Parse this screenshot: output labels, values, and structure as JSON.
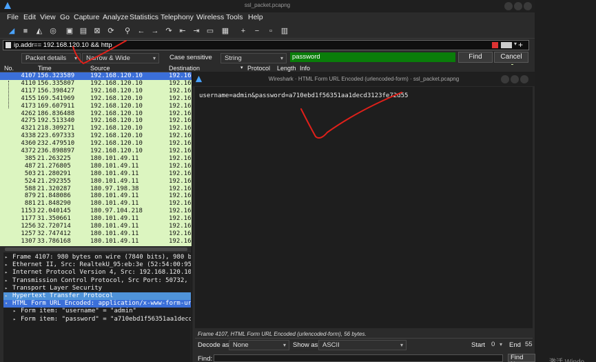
{
  "window": {
    "title": "ssl_packet.pcapng"
  },
  "menu": [
    "File",
    "Edit",
    "View",
    "Go",
    "Capture",
    "Analyze",
    "Statistics",
    "Telephony",
    "Wireless",
    "Tools",
    "Help"
  ],
  "toolbar_icons": [
    "shark-fin-icon",
    "stop-icon",
    "restart-icon",
    "options-gear-icon",
    "open-file-icon",
    "save-file-icon",
    "close-file-icon",
    "reload-icon",
    "find-packet-icon",
    "go-back-icon",
    "go-forward-icon",
    "go-to-packet-icon",
    "first-packet-icon",
    "last-packet-icon",
    "autoscroll-icon",
    "colorize-icon",
    "zoom-in-icon",
    "zoom-out-icon",
    "normal-size-icon",
    "resize-columns-icon"
  ],
  "filter": {
    "value": "ip.addr== 192.168.120.10 && http",
    "plus": "+"
  },
  "search": {
    "area": "Packet details",
    "char": "Narrow & Wide",
    "case": "Case sensitive",
    "type": "String",
    "value": "password",
    "find": "Find",
    "cancel": "Cancel"
  },
  "columns": [
    "No.",
    "Time",
    "Source",
    "Destination",
    "Protocol",
    "Length",
    "Info"
  ],
  "packets": [
    {
      "no": "4107",
      "time": "156.323589",
      "src": "192.168.120.10",
      "dst": "192.16",
      "selected": true
    },
    {
      "no": "4110",
      "time": "156.335807",
      "src": "192.168.120.10",
      "dst": "192.16"
    },
    {
      "no": "4117",
      "time": "156.398427",
      "src": "192.168.120.10",
      "dst": "192.16"
    },
    {
      "no": "4155",
      "time": "169.541969",
      "src": "192.168.120.10",
      "dst": "192.16"
    },
    {
      "no": "4173",
      "time": "169.607911",
      "src": "192.168.120.10",
      "dst": "192.16"
    },
    {
      "no": "4262",
      "time": "186.836488",
      "src": "192.168.120.10",
      "dst": "192.16"
    },
    {
      "no": "4275",
      "time": "192.513340",
      "src": "192.168.120.10",
      "dst": "192.16"
    },
    {
      "no": "4321",
      "time": "218.309271",
      "src": "192.168.120.10",
      "dst": "192.16"
    },
    {
      "no": "4338",
      "time": "223.697333",
      "src": "192.168.120.10",
      "dst": "192.16"
    },
    {
      "no": "4360",
      "time": "232.479510",
      "src": "192.168.120.10",
      "dst": "192.16"
    },
    {
      "no": "4372",
      "time": "236.898897",
      "src": "192.168.120.10",
      "dst": "192.16"
    },
    {
      "no": "385",
      "time": "21.263225",
      "src": "180.101.49.11",
      "dst": "192.16"
    },
    {
      "no": "487",
      "time": "21.276805",
      "src": "180.101.49.11",
      "dst": "192.16"
    },
    {
      "no": "503",
      "time": "21.280291",
      "src": "180.101.49.11",
      "dst": "192.16"
    },
    {
      "no": "524",
      "time": "21.292355",
      "src": "180.101.49.11",
      "dst": "192.16"
    },
    {
      "no": "588",
      "time": "21.320287",
      "src": "180.97.198.38",
      "dst": "192.16"
    },
    {
      "no": "879",
      "time": "21.848086",
      "src": "180.101.49.11",
      "dst": "192.16"
    },
    {
      "no": "881",
      "time": "21.848290",
      "src": "180.101.49.11",
      "dst": "192.16"
    },
    {
      "no": "1153",
      "time": "22.040145",
      "src": "180.97.104.218",
      "dst": "192.16"
    },
    {
      "no": "1177",
      "time": "31.350661",
      "src": "180.101.49.11",
      "dst": "192.16"
    },
    {
      "no": "1256",
      "time": "32.720714",
      "src": "180.101.49.11",
      "dst": "192.16"
    },
    {
      "no": "1257",
      "time": "32.747412",
      "src": "180.101.49.11",
      "dst": "192.16"
    },
    {
      "no": "1307",
      "time": "33.786168",
      "src": "180.101.49.11",
      "dst": "192.16"
    }
  ],
  "details": [
    {
      "text": "Frame 4107: 980 bytes on wire (7840 bits), 980 b",
      "indent": 0,
      "tri": "▸"
    },
    {
      "text": "Ethernet II, Src: RealtekU_95:eb:3e (52:54:00:95",
      "indent": 0,
      "tri": "▸"
    },
    {
      "text": "Internet Protocol Version 4, Src: 192.168.120.10",
      "indent": 0,
      "tri": "▸"
    },
    {
      "text": "Transmission Control Protocol, Src Port: 50732,",
      "indent": 0,
      "tri": "▸"
    },
    {
      "text": "Transport Layer Security",
      "indent": 0,
      "tri": "▸"
    },
    {
      "text": "Hypertext Transfer Protocol",
      "indent": 0,
      "tri": "▸",
      "hl": true
    },
    {
      "text": "HTML Form URL Encoded: application/x-www-form-ur",
      "indent": 0,
      "tri": "▾",
      "sel": true
    },
    {
      "text": "Form item: \"username\" = \"admin\"",
      "indent": 1,
      "tri": "▸"
    },
    {
      "text": "Form item: \"password\" = \"a710ebd1f56351aa1decd",
      "indent": 1,
      "tri": "▸"
    }
  ],
  "dialog": {
    "title": "Wireshark · HTML Form URL Encoded (urlencoded-form) · ssl_packet.pcapng",
    "content": "username=admin&password=a710ebd1f56351aa1decd3123fe72d55",
    "status": "Frame 4107, HTML Form URL Encoded (urlencoded-form), 56 bytes.",
    "decode_label": "Decode as",
    "decode_value": "None",
    "show_label": "Show as",
    "show_value": "ASCII",
    "start_label": "Start",
    "start_value": "0",
    "end_label": "End",
    "end_value": "55",
    "find_label": "Find:",
    "find_next": "Find Nex"
  },
  "watermark": "激活 Windo",
  "colors": {
    "packet_bg": "#dcf5c0",
    "selected": "#3b6fd9",
    "search_green": "#0a7d0a",
    "annotation": "#e0201a"
  }
}
